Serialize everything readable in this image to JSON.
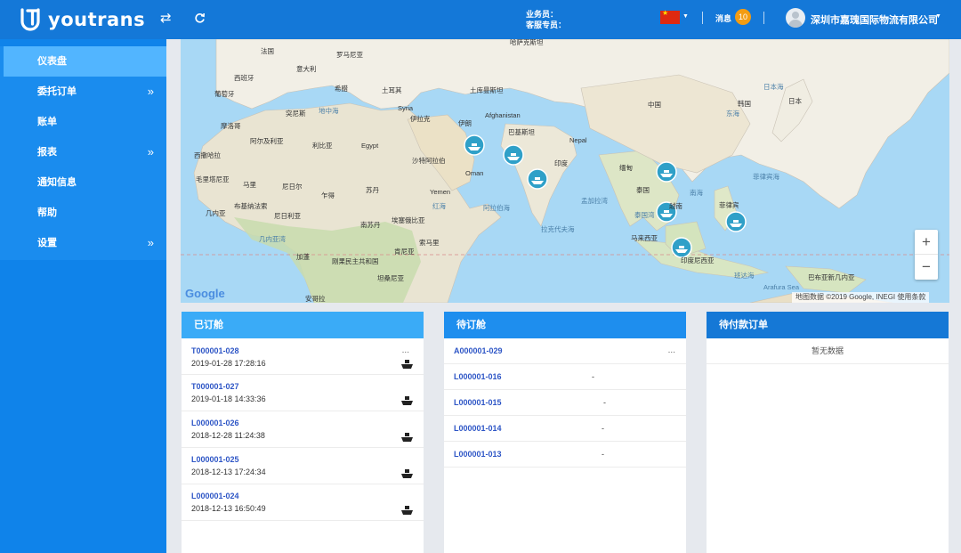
{
  "header": {
    "logo_text": "youtrans",
    "swap_icon": "swap-icon",
    "refresh_icon": "refresh-icon",
    "staff_label": "业务员：",
    "service_label": "客服专员：",
    "message_label": "消息",
    "message_count": "10",
    "company": "深圳市嘉瑰国际物流有限公司"
  },
  "sidebar": {
    "items": [
      {
        "label": "仪表盘"
      },
      {
        "label": "委托订单"
      },
      {
        "label": "账单"
      },
      {
        "label": "报表"
      },
      {
        "label": "通知信息"
      },
      {
        "label": "帮助"
      },
      {
        "label": "设置"
      }
    ]
  },
  "map": {
    "labels": [
      "法国",
      "罗马尼亚",
      "哈萨克斯坦",
      "意大利",
      "西班牙",
      "葡萄牙",
      "希腊",
      "土耳其",
      "土库曼斯坦",
      "中国",
      "日本",
      "韩国",
      "日本海",
      "东海",
      "摩洛哥",
      "阿尔及利亚",
      "突尼斯",
      "利比亚",
      "Egypt",
      "伊拉克",
      "Syria",
      "伊朗",
      "Afghanistan",
      "巴基斯坦",
      "Nepal",
      "印度",
      "缅甸",
      "泰国",
      "越南",
      "菲律宾",
      "南海",
      "菲律宾海",
      "沙特阿拉伯",
      "Oman",
      "Yemen",
      "阿拉伯海",
      "孟加拉湾",
      "红海",
      "苏丹",
      "乍得",
      "尼日尔",
      "马里",
      "毛里塔尼亚",
      "西撒哈拉",
      "几内亚",
      "布基纳法索",
      "尼日利亚",
      "埃塞俄比亚",
      "南苏丹",
      "索马里",
      "肯尼亚",
      "刚果民主共和国",
      "坦桑尼亚",
      "几内亚湾",
      "拉克代夫海",
      "马来西亚",
      "印度尼西亚",
      "泰国湾",
      "班达海",
      "Arafura Sea",
      "巴布亚新几内亚",
      "地中海",
      "安哥拉",
      "加蓬"
    ],
    "zoom_in": "+",
    "zoom_out": "−",
    "attribution": "地图数据 ©2019 Google, INEGI   使用条款",
    "google": "Google"
  },
  "panels": {
    "booked": {
      "title": "已订舱",
      "more": "...",
      "rows": [
        {
          "code": "T000001-028",
          "date": "2019-01-28 17:28:16"
        },
        {
          "code": "T000001-027",
          "date": "2019-01-18 14:33:36"
        },
        {
          "code": "L000001-026",
          "date": "2018-12-28 11:24:38"
        },
        {
          "code": "L000001-025",
          "date": "2018-12-13 17:24:34"
        },
        {
          "code": "L000001-024",
          "date": "2018-12-13 16:50:49"
        }
      ]
    },
    "pending": {
      "title": "待订舱",
      "more": "...",
      "rows": [
        {
          "code": "A000001-029",
          "value": ""
        },
        {
          "code": "L000001-016",
          "value": "-"
        },
        {
          "code": "L000001-015",
          "value": "-"
        },
        {
          "code": "L000001-014",
          "value": "-"
        },
        {
          "code": "L000001-013",
          "value": "-"
        }
      ]
    },
    "unpaid": {
      "title": "待付款订单",
      "empty": "暂无数据"
    }
  },
  "colors": {
    "header": "#1478d8",
    "sidebar": "#0f83ea",
    "sidebar_active": "#52b5ff",
    "panel_booked": "#3aabf7",
    "panel_pending": "#1e8eee",
    "panel_unpaid": "#1578d6",
    "link": "#2e56c6",
    "badge": "#f39c12"
  }
}
